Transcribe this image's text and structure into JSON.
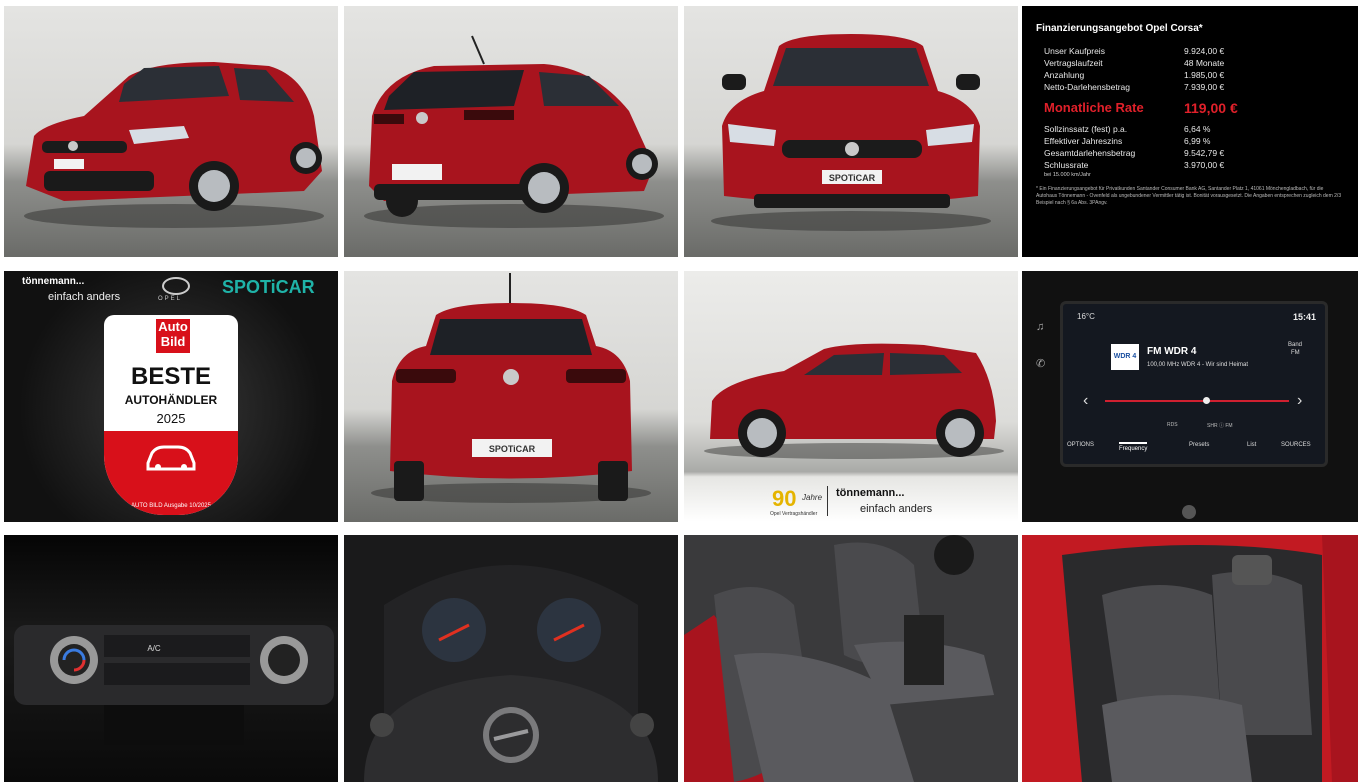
{
  "finance": {
    "title": "Finanzierungsangebot Opel Corsa*",
    "rows": [
      {
        "label": "Unser Kaufpreis",
        "value": "9.924,00 €"
      },
      {
        "label": "Vertragslaufzeit",
        "value": "48 Monate"
      },
      {
        "label": "Anzahlung",
        "value": "1.985,00 €"
      },
      {
        "label": "Netto-Darlehensbetrag",
        "value": "7.939,00 €"
      }
    ],
    "rate_label": "Monatliche Rate",
    "rate_value": "119,00 €",
    "rows2": [
      {
        "label": "Sollzinssatz (fest) p.a.",
        "value": "6,64 %"
      },
      {
        "label": "Effektiver Jahreszins",
        "value": "6,99 %"
      },
      {
        "label": "Gesamtdarlehensbetrag",
        "value": "9.542,79 €"
      },
      {
        "label": "Schlussrate",
        "value": "3.970,00 €"
      }
    ],
    "km_note": "bei 15.000 km/Jahr",
    "footnote": "* Ein Finanzierungsangebot für Privatkunden Santander Consumer Bank AG, Santander Platz 1, 41061 Mönchengladbach, für die Autohaus Tönnemann - Ovenfeld als ungebundener Vermittler tätig ist. Bonität vorausgesetzt. Die Angaben entsprechen zugleich dem 2/3 Beispiel nach § 6a Abs. 3PAngv."
  },
  "award": {
    "dealer_name": "tönnemann...",
    "dealer_slogan": "einfach anders",
    "brand": "OPEL",
    "spoticar": "SPOTiCAR",
    "badge_top": "Auto",
    "badge_bottom": "Bild",
    "beste": "BESTE",
    "autohaendler": "AUTOHÄNDLER",
    "year": "2025",
    "source": "AUTO BILD Ausgabe 10/2025"
  },
  "banner": {
    "years_number": "90",
    "years_word": "Jahre",
    "partner": "Opel Vertragshändler",
    "dealer_name": "tönnemann...",
    "dealer_slogan": "einfach anders"
  },
  "plates": {
    "spoticar": "SPOTiCAR"
  },
  "radio": {
    "temp": "16°C",
    "time": "15:41",
    "station_logo": "WDR 4",
    "station": "FM  WDR 4",
    "freq_line": "100,00 MHz  WDR 4 - Wir sind Heimat",
    "band_label": "Band",
    "band_value": "FM",
    "tabs": [
      "OPTIONS",
      "Frequency",
      "Presets",
      "List",
      "SOURCES"
    ],
    "rds": "RDS",
    "hd": "SHR ⓘ FM"
  },
  "climate": {
    "ac_label": "A/C"
  },
  "colors": {
    "car_red": "#a8141e",
    "spoticar_teal": "#1fb3a8",
    "finance_red": "#e0202a"
  }
}
